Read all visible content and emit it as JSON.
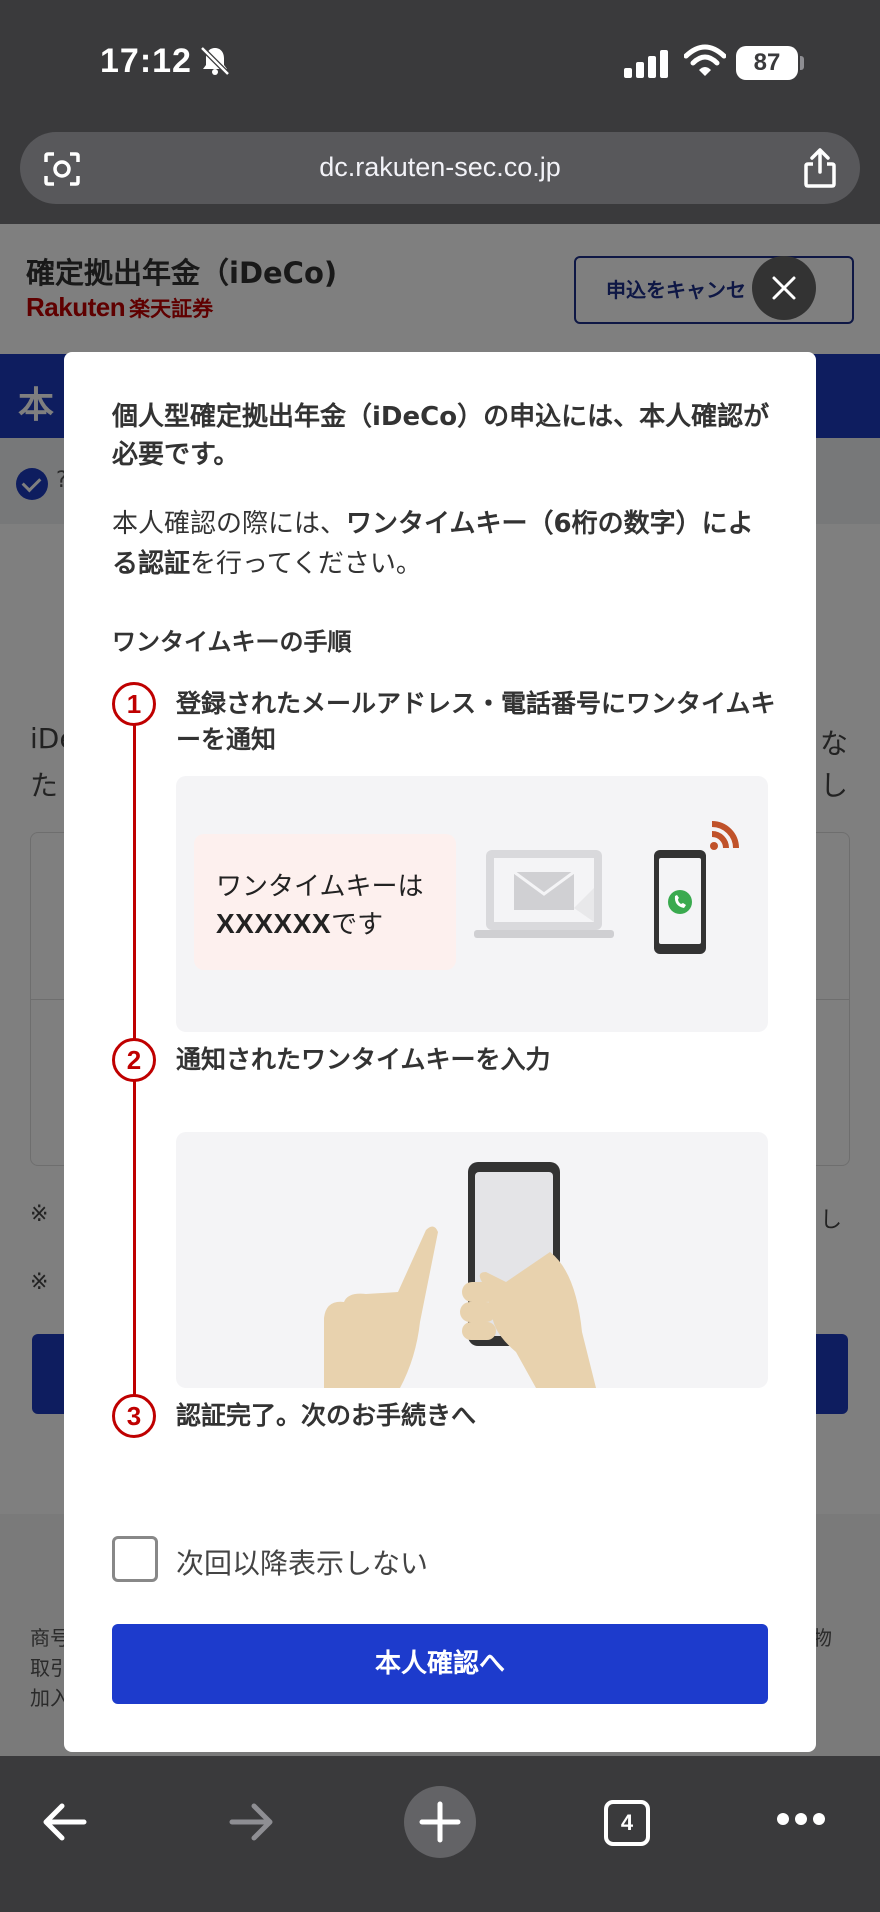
{
  "status_bar": {
    "time": "17:12",
    "battery": "87"
  },
  "browser": {
    "url": "dc.rakuten-sec.co.jp",
    "tab_count": "4"
  },
  "background_page": {
    "title": "確定拠出年金（iDeCo)",
    "logo_brand": "Rakuten",
    "logo_jp": "楽天証券",
    "cancel_button": "申込をキャンセ",
    "header_fragment": "本",
    "step_fragment": "?",
    "body_fragments": [
      "iDe",
      "た",
      "な",
      "し"
    ],
    "note_fragments": [
      "※",
      "※"
    ],
    "footer_fragments": [
      "商号",
      "取引",
      "加入",
      "物"
    ]
  },
  "modal": {
    "intro": "個人型確定拠出年金（iDeCo）の申込には、本人確認が必要です。",
    "instruction_prefix": "本人確認の際には、",
    "instruction_bold": "ワンタイムキー（6桁の数字）による認証",
    "instruction_suffix": "を行ってください。",
    "steps_heading": "ワンタイムキーの手順",
    "steps": [
      {
        "number": "1",
        "text": "登録されたメールアドレス・電話番号にワンタイムキーを通知"
      },
      {
        "number": "2",
        "text": "通知されたワンタイムキーを入力"
      },
      {
        "number": "3",
        "text": "認証完了。次のお手続きへ"
      }
    ],
    "otp_message_line1": "ワンタイムキーは",
    "otp_code": "XXXXXX",
    "otp_message_suffix": "です",
    "dont_show_label": "次回以降表示しない",
    "confirm_button": "本人確認へ"
  },
  "colors": {
    "brand_red": "#bf0000",
    "primary_blue": "#1d3bcc",
    "chrome_dark": "#3a3a3c"
  },
  "icons": [
    "bell-slash-icon",
    "signal-icon",
    "wifi-icon",
    "scan-icon",
    "share-icon",
    "close-icon",
    "mail-icon",
    "phone-call-icon",
    "back-arrow-icon",
    "forward-arrow-icon",
    "new-tab-plus-icon",
    "tabs-icon",
    "more-icon"
  ]
}
